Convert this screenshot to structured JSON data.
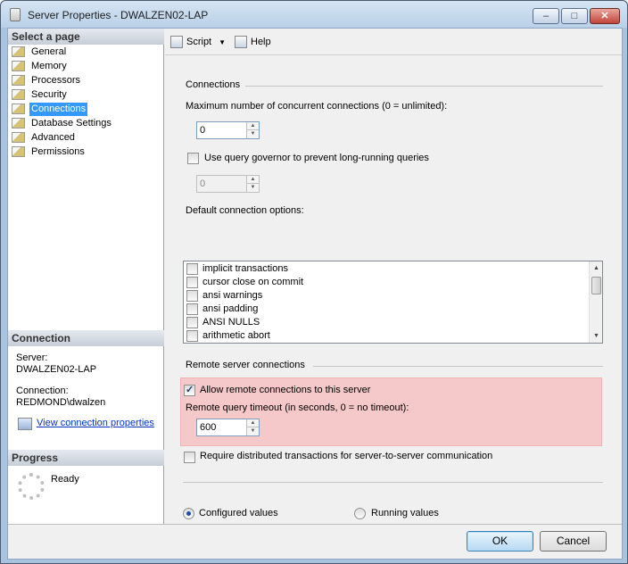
{
  "window": {
    "title": "Server Properties - DWALZEN02-LAP",
    "min": "–",
    "max": "□",
    "close": "✕"
  },
  "sidebar": {
    "header": "Select a page",
    "items": [
      {
        "label": "General"
      },
      {
        "label": "Memory"
      },
      {
        "label": "Processors"
      },
      {
        "label": "Security"
      },
      {
        "label": "Connections",
        "selected": true
      },
      {
        "label": "Database Settings"
      },
      {
        "label": "Advanced"
      },
      {
        "label": "Permissions"
      }
    ]
  },
  "connection": {
    "header": "Connection",
    "server_label": "Server:",
    "server_value": "DWALZEN02-LAP",
    "connection_label": "Connection:",
    "connection_value": "REDMOND\\dwalzen",
    "link": "View connection properties"
  },
  "progress": {
    "header": "Progress",
    "status": "Ready"
  },
  "toolbar": {
    "script": "Script",
    "help": "Help"
  },
  "connections": {
    "group": "Connections",
    "max_label": "Maximum number of concurrent connections (0 = unlimited):",
    "max_value": "0",
    "governor_label": "Use query governor to prevent long-running queries",
    "governor_value": "0",
    "default_label": "Default connection options:",
    "options": [
      "implicit transactions",
      "cursor close on commit",
      "ansi warnings",
      "ansi padding",
      "ANSI NULLS",
      "arithmetic abort"
    ]
  },
  "remote": {
    "group": "Remote server connections",
    "allow_label": "Allow remote connections to this server",
    "allow_checked": true,
    "timeout_label": "Remote query timeout (in seconds, 0 = no timeout):",
    "timeout_value": "600",
    "distributed_label": "Require distributed transactions for server-to-server communication"
  },
  "values": {
    "configured": "Configured values",
    "running": "Running values"
  },
  "buttons": {
    "ok": "OK",
    "cancel": "Cancel"
  }
}
